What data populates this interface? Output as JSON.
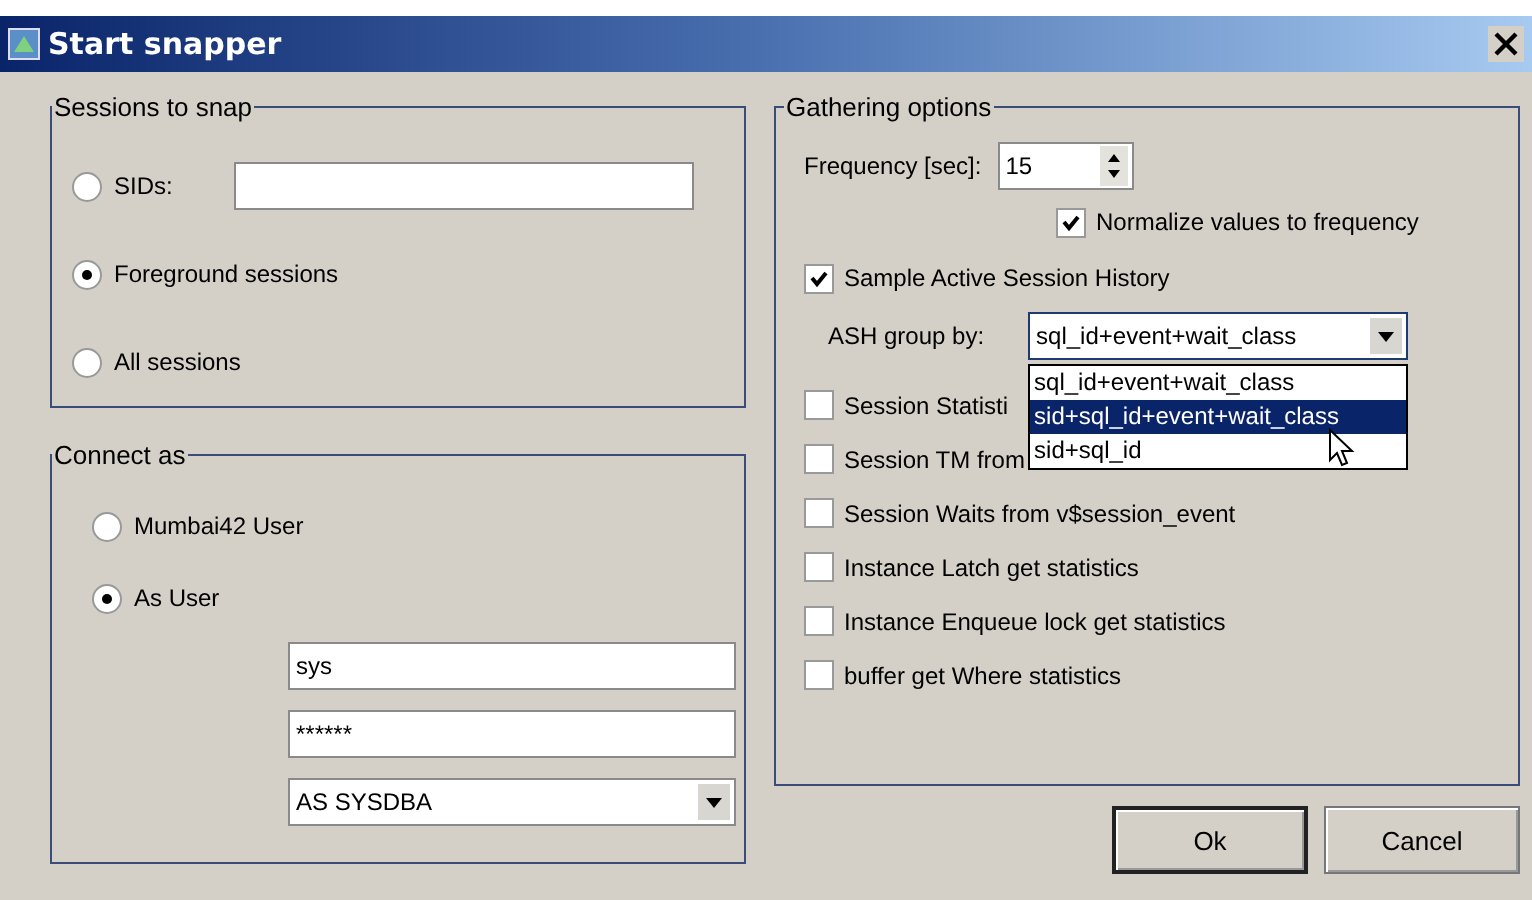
{
  "window": {
    "title": "Start snapper"
  },
  "sessions_to_snap": {
    "legend": "Sessions to snap",
    "options": [
      {
        "label": "SIDs:",
        "selected": false,
        "kind": "field"
      },
      {
        "label": "Foreground sessions",
        "selected": true,
        "kind": "plain"
      },
      {
        "label": "All sessions",
        "selected": false,
        "kind": "plain"
      }
    ]
  },
  "connect_as": {
    "legend": "Connect as",
    "options": [
      {
        "label": "Mumbai42 User",
        "selected": false
      },
      {
        "label": "As User",
        "selected": true
      }
    ],
    "username": "sys",
    "password": "******",
    "role": "AS SYSDBA"
  },
  "gathering_options": {
    "legend": "Gathering options",
    "frequency_label": "Frequency [sec]:",
    "frequency": "15",
    "normalize": {
      "label": "Normalize values to frequency",
      "checked": true
    },
    "sample_ash": {
      "label": "Sample Active Session History",
      "checked": true
    },
    "ash_group_label": "ASH group by:",
    "ash_group_value": "sql_id+event+wait_class",
    "ash_group_options": [
      {
        "label": "sql_id+event+wait_class",
        "selected": false
      },
      {
        "label": "sid+sql_id+event+wait_class",
        "selected": true
      },
      {
        "label": "sid+sql_id",
        "selected": false
      }
    ],
    "statistics": [
      {
        "label": "Session Statisti",
        "checked": false
      },
      {
        "label": "Session TM from",
        "checked": false
      },
      {
        "label": "Session Waits from v$session_event",
        "checked": false
      },
      {
        "label": "Instance Latch get statistics",
        "checked": false
      },
      {
        "label": "Instance Enqueue lock get statistics",
        "checked": false
      },
      {
        "label": "buffer get Where statistics",
        "checked": false
      }
    ]
  },
  "buttons": [
    {
      "label": "Ok",
      "default": true
    },
    {
      "label": "Cancel",
      "default": false
    }
  ]
}
